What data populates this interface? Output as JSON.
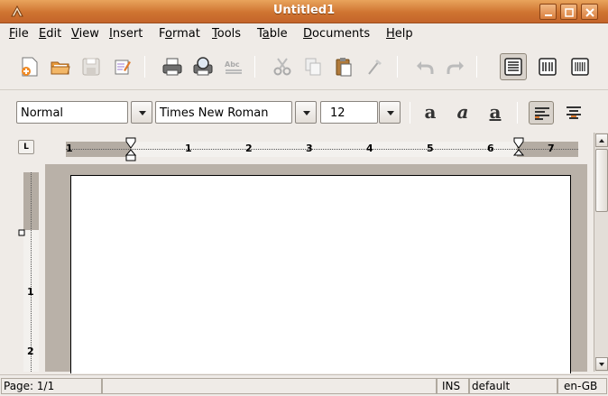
{
  "window": {
    "title": "Untitled1",
    "app_icon": "abiword-icon",
    "controls": [
      "minimize-icon",
      "maximize-icon",
      "close-icon"
    ]
  },
  "menu": {
    "items": [
      {
        "label": "File",
        "mnemonic": "F",
        "rest": "ile"
      },
      {
        "label": "Edit",
        "mnemonic": "E",
        "rest": "dit"
      },
      {
        "label": "View",
        "mnemonic": "V",
        "rest": "iew"
      },
      {
        "label": "Insert",
        "mnemonic": "I",
        "rest": "nsert"
      },
      {
        "label": "Format",
        "pre": "F",
        "mnemonic": "o",
        "rest": "rmat"
      },
      {
        "label": "Tools",
        "mnemonic": "T",
        "rest": "ools"
      },
      {
        "label": "Table",
        "pre": "T",
        "mnemonic": "a",
        "rest": "ble"
      },
      {
        "label": "Documents",
        "mnemonic": "D",
        "rest": "ocuments"
      },
      {
        "label": "Help",
        "mnemonic": "H",
        "rest": "elp"
      }
    ]
  },
  "toolbar": {
    "icons": [
      "new-document-icon",
      "open-folder-icon",
      "save-icon",
      "edit-document-icon",
      "print-icon",
      "print-preview-icon",
      "spellcheck-icon",
      "cut-icon",
      "copy-icon",
      "paste-icon",
      "format-painter-icon",
      "undo-icon",
      "redo-icon",
      "normal-layout-icon",
      "web-layout-icon",
      "print-layout-icon"
    ]
  },
  "format": {
    "style_value": "Normal",
    "font_value": "Times New Roman",
    "size_value": "12",
    "bold_glyph": "a",
    "italic_glyph": "a",
    "underline_glyph": "a"
  },
  "ruler": {
    "corner_label": "L",
    "h_numbers": [
      "1",
      "1",
      "2",
      "3",
      "4",
      "5",
      "6",
      "7"
    ],
    "v_numbers": [
      "1",
      "2"
    ]
  },
  "status": {
    "page": "Page: 1/1",
    "mode": "INS",
    "style": "default",
    "lang": "en-GB"
  },
  "colors": {
    "titlebar": "#cf7431",
    "page_background": "#b9b1a8"
  }
}
